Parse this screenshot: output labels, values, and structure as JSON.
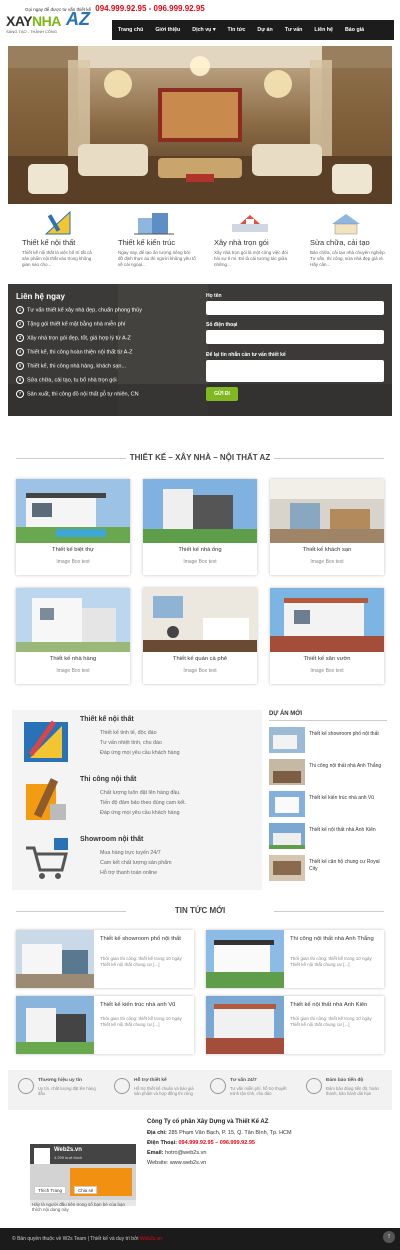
{
  "header": {
    "hotline_label": "Gọi ngay để được tư vấn thiết kế",
    "hotline_numbers": "094.999.92.95 - 096.999.92.95",
    "logo_part1": "XAY",
    "logo_part2": "NHA",
    "logo_part3": "AZ",
    "logo_slogan": "SÁNG TẠO - THÀNH CÔNG",
    "nav": [
      "Trang chủ",
      "Giới thiệu",
      "Dịch vụ ▾",
      "Tin tức",
      "Dự án",
      "Tư vấn",
      "Liên hệ",
      "Báo giá"
    ]
  },
  "features": [
    {
      "title": "Thiết kế nội thất",
      "desc": "Thiết kế nội thất là việc bố trí tất cả sản phẩm nội thất vào trong không gian sao cho..."
    },
    {
      "title": "Thiết kế kiến trúc",
      "desc": "Ngay nay, để tạo ẩn tượng riêng bởi đồ định thực au thì người không yêu tố về cái ngoại..."
    },
    {
      "title": "Xây nhà trọn gói",
      "desc": "Xây nhà trọn gói là một công việc đòi hỏi sự tỉ mỉ. Đó là cái tương tác giữa những..."
    },
    {
      "title": "Sửa chữa, cải tạo",
      "desc": "Bảo chữa, cải tạo nhà chuyên nghiệp. Tư vấn, thi công, sửa nhà đẹp giá rẻ. Hãy cân..."
    }
  ],
  "contact": {
    "title": "Liên hệ ngay",
    "items": [
      {
        "n": "1",
        "text": "Tư vấn thiết kế xây nhà đẹp, chuẩn phong thủy"
      },
      {
        "n": "2",
        "text": "Tặng gói thiết kế mặt bằng nhà miễn phí"
      },
      {
        "n": "3",
        "text": "Xây nhà trọn gói đẹp, tốt, giá hợp lý từ A-Z"
      },
      {
        "n": "4",
        "text": "Thiết kế, thi công hoàn thiện nội thất từ A-Z"
      },
      {
        "n": "5",
        "text": "Thiết kế, thi công nhà hàng, khách sạn..."
      },
      {
        "n": "6",
        "text": "Sửa chữa, cải tạo, tu bổ nhà trọn gói"
      },
      {
        "n": "7",
        "text": "Sản xuất, thi công đồ nội thất gỗ tự nhiên, CN"
      }
    ],
    "label_name": "Họ tên",
    "label_phone": "Số điện thoại",
    "label_message": "Để lại tin nhắn cần tư vấn thiết kế",
    "send": "GỬI ĐI"
  },
  "products": {
    "title": "THIẾT KẾ – XÂY NHÀ – NỘI THẤT AZ",
    "cards": [
      {
        "title": "Thiết kế biệt thự",
        "sub": "Image Box text"
      },
      {
        "title": "Thiết kế nhà ống",
        "sub": "Image Box text"
      },
      {
        "title": "Thiết kế khách sạn",
        "sub": "Image Box text"
      },
      {
        "title": "Thiết kế nhà hàng",
        "sub": "Image Box text"
      },
      {
        "title": "Thiết kế quán cà phê",
        "sub": "Image Box text"
      },
      {
        "title": "Thiết kế sân vườn",
        "sub": "Image Box text"
      }
    ]
  },
  "services": [
    {
      "title": "Thiết kế nội thất",
      "lines": [
        "Thiết kế tinh tế, độc đáo",
        "Tư vấn nhiệt tình, chu đáo",
        "Đáp ứng mọi yêu cầu khách hàng"
      ]
    },
    {
      "title": "Thi công nội thất",
      "lines": [
        "Chất lượng luôn đặt lên hàng đầu.",
        "Tiến độ đảm bảo theo đúng cam kết.",
        "Đáp ứng mọi yêu cầu khách hàng"
      ]
    },
    {
      "title": "Showroom nội thất",
      "lines": [
        "Mua hàng trực tuyến 24/7",
        "Cam kết chất lượng sản phẩm",
        "Hỗ trợ thanh toán online"
      ]
    }
  ],
  "projects": {
    "title": "DỰ ÁN MỚI",
    "items": [
      "Thiết kế showroom phố nội thất",
      "Thi công nội thất nhà Anh Thắng",
      "Thiết kế kiến trúc nhà anh Vũ",
      "Thiết kế nội thất nhà Anh Kiên",
      "Thiết kế căn hộ chung cư Royal City"
    ]
  },
  "news": {
    "title": "TIN TỨC MỚI",
    "items": [
      {
        "title": "Thiết kế showroom phố nội thất",
        "desc": "Thời gian thi công: thiết kế trong 10 ngày Thiết kế nội thất chung cư [...]"
      },
      {
        "title": "Thi công nội thất nhà Anh Thắng",
        "desc": "Thời gian thi công: thiết kế trong 10 ngày Thiết kế nội thất chung cư [...]"
      },
      {
        "title": "Thiết kế kiến trúc nhà anh Vũ",
        "desc": "Thời gian thi công: thiết kế trong 10 ngày Thiết kế nội thất chung cư [...]"
      },
      {
        "title": "Thiết kế nội thất nhà Anh Kiên",
        "desc": "Thời gian thi công: thiết kế trong 10 ngày Thiết kế nội thất chung cư [...]"
      }
    ]
  },
  "benefits": [
    {
      "title": "Thương hiệu uy tín",
      "desc": "Uy tín, chất lượng đặt lên hàng đầu"
    },
    {
      "title": "Hỗ trợ thiết kế",
      "desc": "Hỗ trợ thiết kế chuẩn và báo giá sản phẩm và hợp đồng thi công"
    },
    {
      "title": "Tư vấn 24/7",
      "desc": "Tư vấn miễn phí, hỗ trợ thuyết minh tận tình, chu đáo"
    },
    {
      "title": "Đảm bảo tiến độ",
      "desc": "Đảm bảo đúng tiến độ, hoàn thành, bảo hành dài hạn"
    }
  ],
  "footer": {
    "company": "Công Ty cổ phần Xây Dựng và Thiết Kế AZ",
    "address_label": "Địa chỉ:",
    "address": "285 Phạm Văn Bạch, P. 15, Q. Tân Bình, Tp. HCM",
    "phone_label": "Điện Thoại:",
    "phone": "094.999.92.95 – 096.999.92.95",
    "email_label": "Email:",
    "email": "hotro@web2s.vn",
    "website_label": "Website:",
    "website": "www.web2s.vn",
    "fb_name": "Web2s.vn",
    "fb_likes": "4.299 lượt thích",
    "fb_like_btn": "Thích Trang",
    "fb_share_btn": "Chia sẻ",
    "fb_note": "Hãy là người đầu tiên trong số bạn bè của bạn thích nội dung này",
    "copyright_prefix": "© Bản quyền thuộc về W2s Team | Thiết kế và duy trì bởi",
    "copyright_brand": "Web2s.vn"
  },
  "colors": {
    "accent": "#7fb820",
    "brand_blue": "#2a72b8",
    "hotline_red": "#e30613",
    "nav_bg": "#1c1c1c"
  }
}
